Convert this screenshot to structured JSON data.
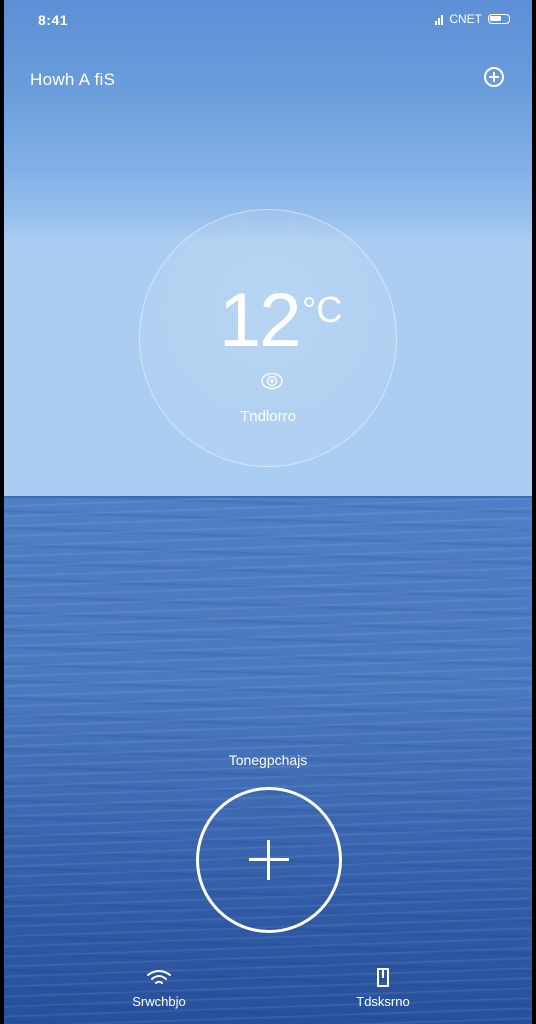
{
  "status_bar": {
    "time": "8:41",
    "carrier": "CNET"
  },
  "header": {
    "title": "Howh A fiS"
  },
  "weather": {
    "temperature": "12",
    "unit": "°C",
    "condition": "Tndlorro",
    "condition_icon": "sun-icon"
  },
  "action": {
    "hint": "Tonegpchajs",
    "button_icon": "plus-icon"
  },
  "bottom_nav": {
    "left_label": "Srwchbjo",
    "left_icon": "wifi-icon",
    "right_label": "Tdsksrno",
    "right_icon": "device-icon"
  },
  "colors": {
    "sky_top": "#5c8fd5",
    "sky_horizon": "#aacdf1",
    "sea_top": "#4f7fc4",
    "sea_bottom": "#27509c",
    "text": "#ffffff"
  }
}
